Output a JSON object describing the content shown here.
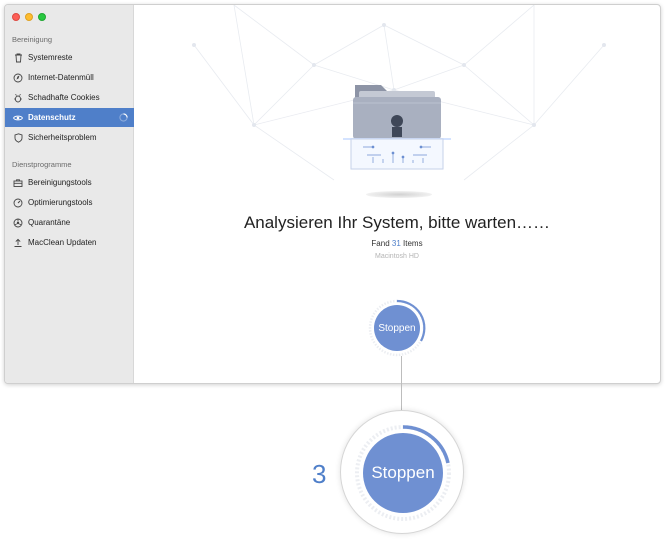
{
  "sidebar": {
    "section_cleaning": "Bereinigung",
    "items": [
      {
        "label": "Systemreste"
      },
      {
        "label": "Internet-Datenmüll"
      },
      {
        "label": "Schadhafte Cookies"
      },
      {
        "label": "Datenschutz"
      },
      {
        "label": "Sicherheitsproblem"
      }
    ],
    "section_services": "Dienstprogramme",
    "services": [
      {
        "label": "Bereinigungstools"
      },
      {
        "label": "Optimierungstools"
      },
      {
        "label": "Quarantäne"
      },
      {
        "label": "MacClean Updaten"
      }
    ]
  },
  "main": {
    "status_title": "Analysieren Ihr System, bitte warten……",
    "found_prefix": "Fand",
    "found_count": "31",
    "found_suffix": "Items",
    "drive": "Macintosh HD",
    "stop_label": "Stoppen"
  },
  "callout": {
    "step_number": "3",
    "stop_label": "Stoppen"
  },
  "colors": {
    "accent": "#4f7fc9",
    "button": "#6f90d2",
    "sidebar_bg": "#e9e9e9"
  }
}
